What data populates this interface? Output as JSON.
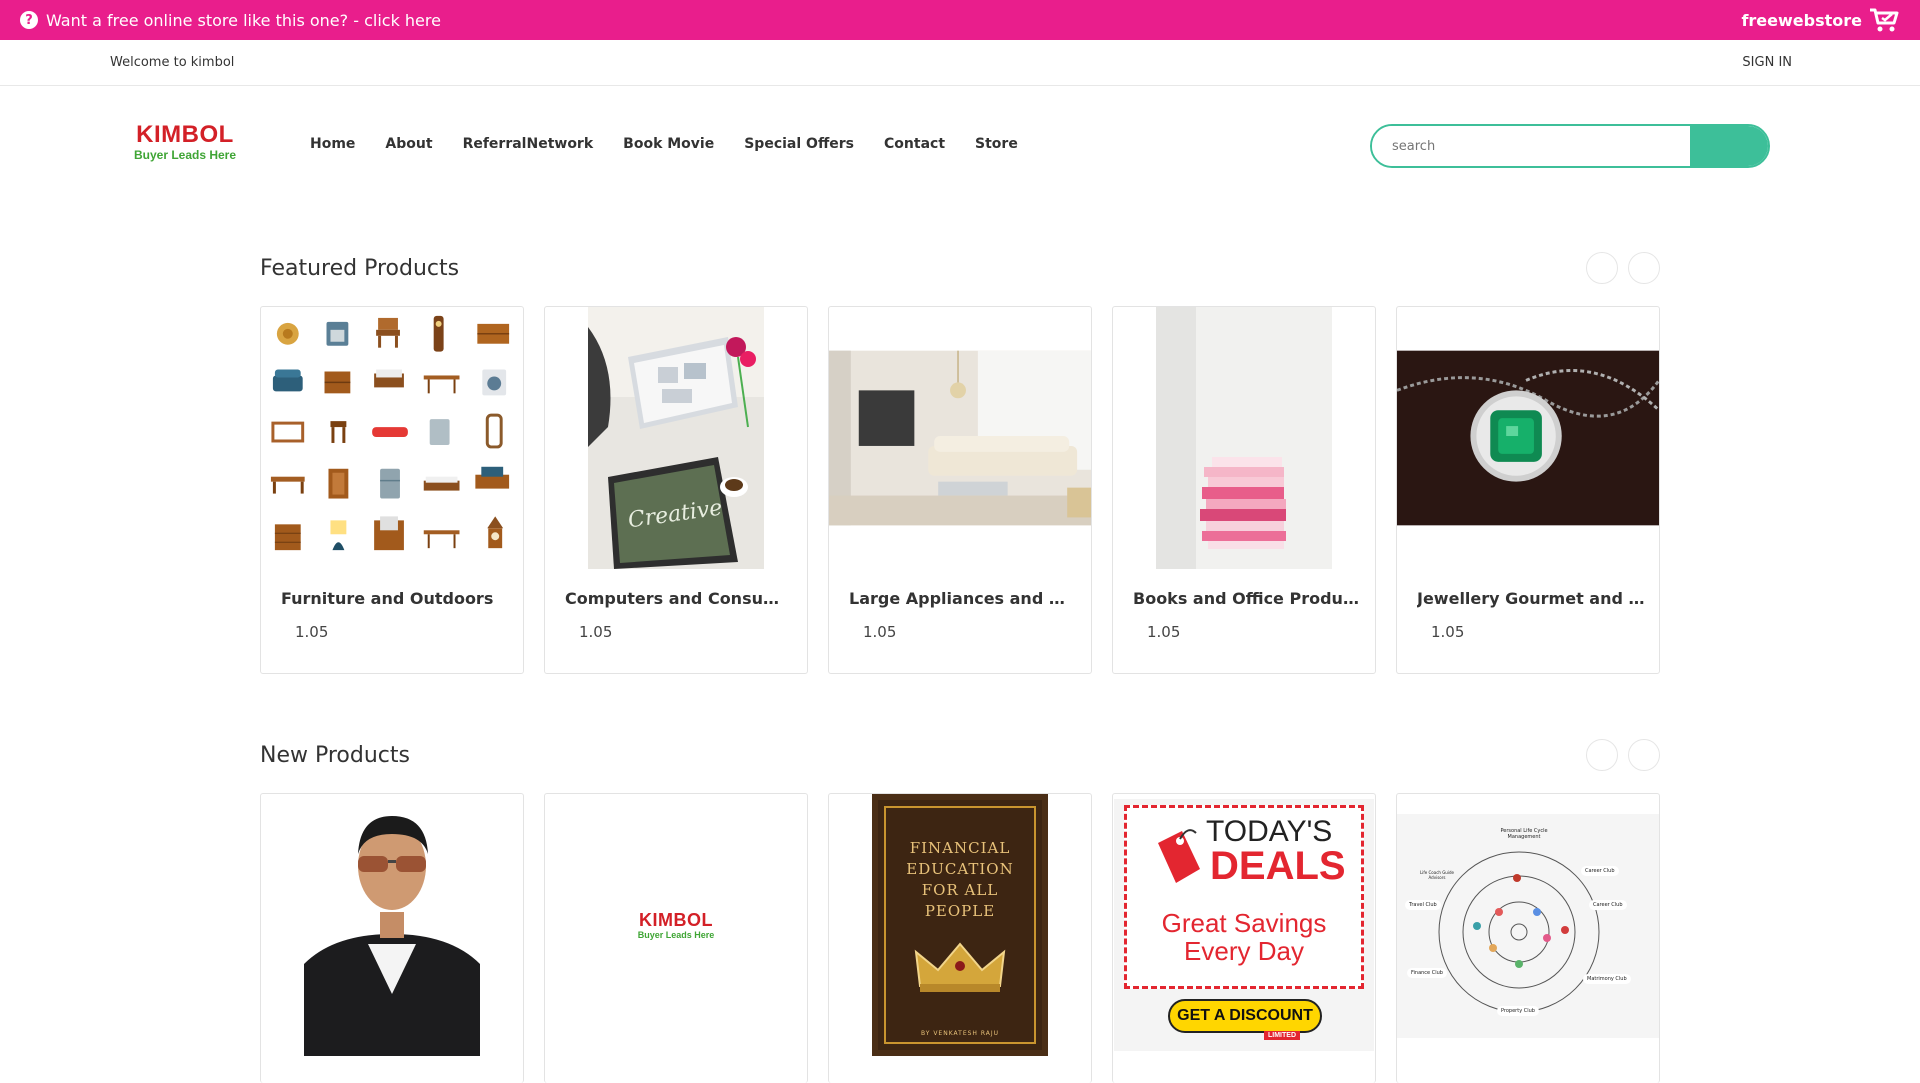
{
  "promo": {
    "text": "Want a free online store like this one? - click here",
    "brand": "freewebstore",
    "question_icon": "question-circle-icon",
    "cart_icon": "shopping-cart-icon"
  },
  "topbar": {
    "welcome": "Welcome to kimbol",
    "signin": "SIGN IN"
  },
  "logo": {
    "title": "KIMBOL",
    "subtitle": "Buyer Leads Here"
  },
  "nav": [
    "Home",
    "About",
    "ReferralNetwork",
    "Book Movie",
    "Special Offers",
    "Contact",
    "Store"
  ],
  "search": {
    "placeholder": "search"
  },
  "featured": {
    "title": "Featured Products",
    "products": [
      {
        "name": "Furniture and Outdoors",
        "price": "1.05"
      },
      {
        "name": "Computers and Consumer Electronics",
        "price": "1.05"
      },
      {
        "name": "Large Appliances and Movables",
        "price": "1.05"
      },
      {
        "name": "Books and Office Products",
        "price": "1.05"
      },
      {
        "name": "Jewellery Gourmet and Kitchen",
        "price": "1.05"
      }
    ]
  },
  "new_products": {
    "title": "New Products",
    "book_cover": [
      "FINANCIAL",
      "EDUCATION",
      "FOR ALL",
      "PEOPLE"
    ],
    "book_author": "BY VENKATESH RAJU",
    "deals": {
      "line1": "TODAY'S",
      "line2": "DEALS",
      "line3": "Great Savings",
      "line4": "Every Day",
      "button": "GET A DISCOUNT",
      "tag": "LIMITED"
    },
    "club_labels": [
      "Personal Life Cycle Management",
      "Career Club",
      "Life Coach Guide Advisors",
      "Travel Club",
      "Career Club",
      "Finance Club",
      "Matrimony Club",
      "Property Club"
    ]
  },
  "colors": {
    "promo_bg": "#e91e8c",
    "accent": "#3dbf99",
    "logo_red": "#d32027",
    "logo_green": "#3fa535"
  }
}
